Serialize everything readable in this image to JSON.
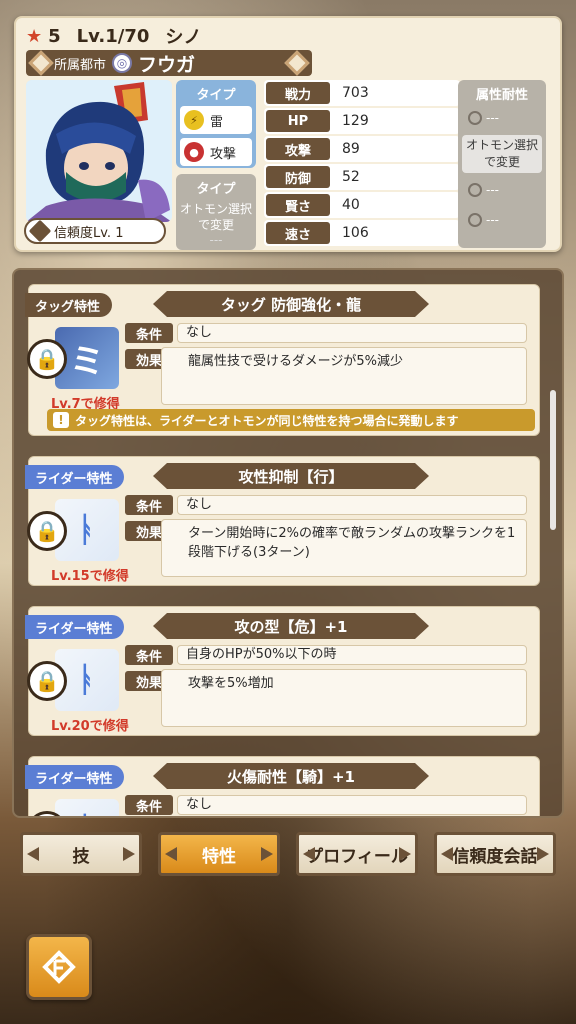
{
  "header": {
    "rarity": "5",
    "level": "Lv.1/70",
    "name": "シノ",
    "city_label": "所属都市",
    "city_name": "フウガ",
    "trust": "信頼度Lv.  1"
  },
  "type": {
    "label": "タイプ",
    "element": "雷",
    "attack_type": "攻撃",
    "otomon_label": "タイプ",
    "otomon_select": "オトモン選択で変更",
    "otomon_value": "---"
  },
  "stats": [
    {
      "label": "戦力",
      "value": "703"
    },
    {
      "label": "HP",
      "value": "129"
    },
    {
      "label": "攻撃",
      "value": "89"
    },
    {
      "label": "防御",
      "value": "52"
    },
    {
      "label": "賢さ",
      "value": "40"
    },
    {
      "label": "速さ",
      "value": "106"
    }
  ],
  "resist": {
    "title": "属性耐性",
    "select_text": "オトモン選択で変更",
    "values": [
      "---",
      "---",
      "---",
      "---"
    ]
  },
  "traits": [
    {
      "kind": "タッグ特性",
      "title": "タッグ 防御強化・龍",
      "learn": "Lv.7で修得",
      "cond_label": "条件",
      "cond": "なし",
      "eff_label": "効果",
      "effect": "龍属性技で受けるダメージが5%減少",
      "note": "タッグ特性は、ライダーとオトモンが同じ特性を持つ場合に発動します"
    },
    {
      "kind": "ライダー特性",
      "title": "攻性抑制【行】",
      "learn": "Lv.15で修得",
      "cond_label": "条件",
      "cond": "なし",
      "eff_label": "効果",
      "effect": "ターン開始時に2%の確率で敵ランダムの攻撃ランクを1段階下げる(3ターン)"
    },
    {
      "kind": "ライダー特性",
      "title": "攻の型【危】+1",
      "learn": "Lv.20で修得",
      "cond_label": "条件",
      "cond": "自身のHPが50%以下の時",
      "eff_label": "効果",
      "effect": "攻撃を5%増加"
    },
    {
      "kind": "ライダー特性",
      "title": "火傷耐性【騎】+1",
      "cond_label": "条件",
      "cond": "なし"
    }
  ],
  "tabs": [
    "技",
    "特性",
    "プロフィール",
    "信頼度会話"
  ],
  "colors": {
    "accent": "#d98a1a",
    "brown": "#6b5238",
    "rider_blue": "#5b7ed4"
  }
}
